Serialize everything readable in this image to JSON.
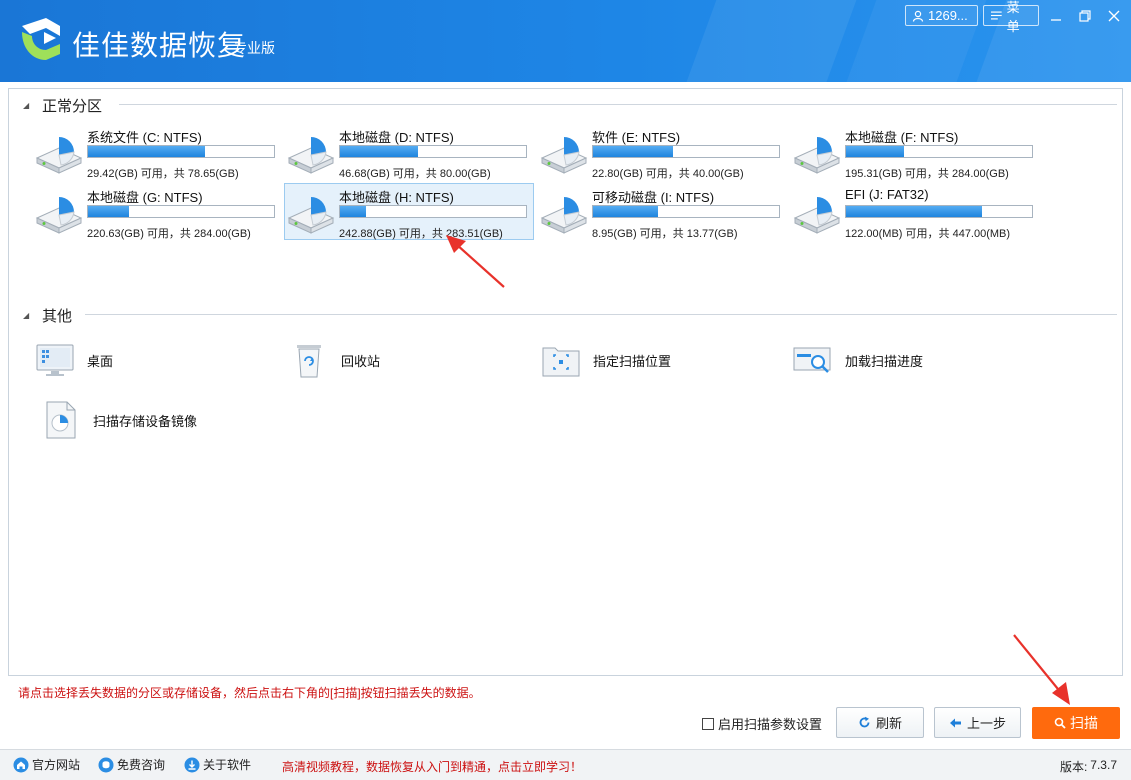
{
  "app": {
    "title": "佳佳数据恢复",
    "edition": "专业版",
    "user_label": "1269...",
    "menu_label": "菜单"
  },
  "colors": {
    "header_blue": "#1e86e6",
    "bar_blue": "#2b8de3",
    "scan_orange": "#ff6a0d",
    "hint_red": "#cc1111"
  },
  "partitions": {
    "title": "正常分区",
    "drives": [
      {
        "name": "系统文件 (C: NTFS)",
        "capacity": "29.42(GB) 可用，共 78.65(GB)",
        "used_fraction": 0.63,
        "selected": false
      },
      {
        "name": "本地磁盘 (D: NTFS)",
        "capacity": "46.68(GB) 可用，共 80.00(GB)",
        "used_fraction": 0.42,
        "selected": false
      },
      {
        "name": "软件 (E: NTFS)",
        "capacity": "22.80(GB) 可用，共 40.00(GB)",
        "used_fraction": 0.43,
        "selected": false
      },
      {
        "name": "本地磁盘 (F: NTFS)",
        "capacity": "195.31(GB) 可用，共 284.00(GB)",
        "used_fraction": 0.31,
        "selected": false
      },
      {
        "name": "本地磁盘 (G: NTFS)",
        "capacity": "220.63(GB) 可用，共 284.00(GB)",
        "used_fraction": 0.22,
        "selected": false
      },
      {
        "name": "本地磁盘 (H: NTFS)",
        "capacity": "242.88(GB) 可用，共 283.51(GB)",
        "used_fraction": 0.14,
        "selected": true
      },
      {
        "name": "可移动磁盘 (I: NTFS)",
        "capacity": "8.95(GB) 可用，共 13.77(GB)",
        "used_fraction": 0.35,
        "selected": false
      },
      {
        "name": "EFI (J: FAT32)",
        "capacity": "122.00(MB) 可用，共 447.00(MB)",
        "used_fraction": 0.73,
        "selected": false
      }
    ]
  },
  "others": {
    "title": "其他",
    "items": [
      {
        "label": "桌面",
        "icon": "desktop-icon"
      },
      {
        "label": "回收站",
        "icon": "recycle-bin-icon"
      },
      {
        "label": "指定扫描位置",
        "icon": "scan-location-icon"
      },
      {
        "label": "加载扫描进度",
        "icon": "load-progress-icon"
      },
      {
        "label": "扫描存储设备镜像",
        "icon": "disk-image-icon"
      }
    ]
  },
  "hint": "请点击选择丢失数据的分区或存储设备，然后点击右下角的[扫描]按钮扫描丢失的数据。",
  "actions": {
    "scan_params_label": "启用扫描参数设置",
    "refresh_label": "刷新",
    "back_label": "上一步",
    "scan_label": "扫描"
  },
  "status": {
    "website_label": "官方网站",
    "consult_label": "免费咨询",
    "about_label": "关于软件",
    "promo": "高清视频教程，数据恢复从入门到精通，点击立即学习！",
    "version_label": "版本:",
    "version_value": "7.3.7"
  }
}
